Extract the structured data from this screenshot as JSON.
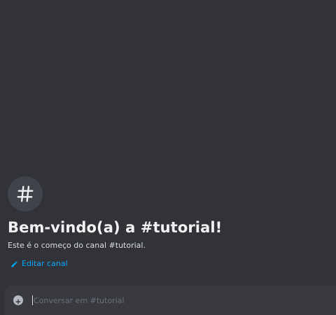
{
  "welcome": {
    "icon": "hashtag-icon",
    "title": "Bem-vindo(a) a #tutorial!",
    "subtitle": "Este é o começo do canal #tutorial.",
    "edit_link": {
      "icon": "pencil-icon",
      "label": "Editar canal"
    }
  },
  "composer": {
    "attach_icon": "plus-circle-icon",
    "placeholder": "Conversar em #tutorial",
    "value": ""
  },
  "colors": {
    "background": "#313338",
    "composer_background": "#383a40",
    "link": "#00a8fc",
    "title": "#f2f3f5",
    "placeholder": "#6d6f78"
  }
}
